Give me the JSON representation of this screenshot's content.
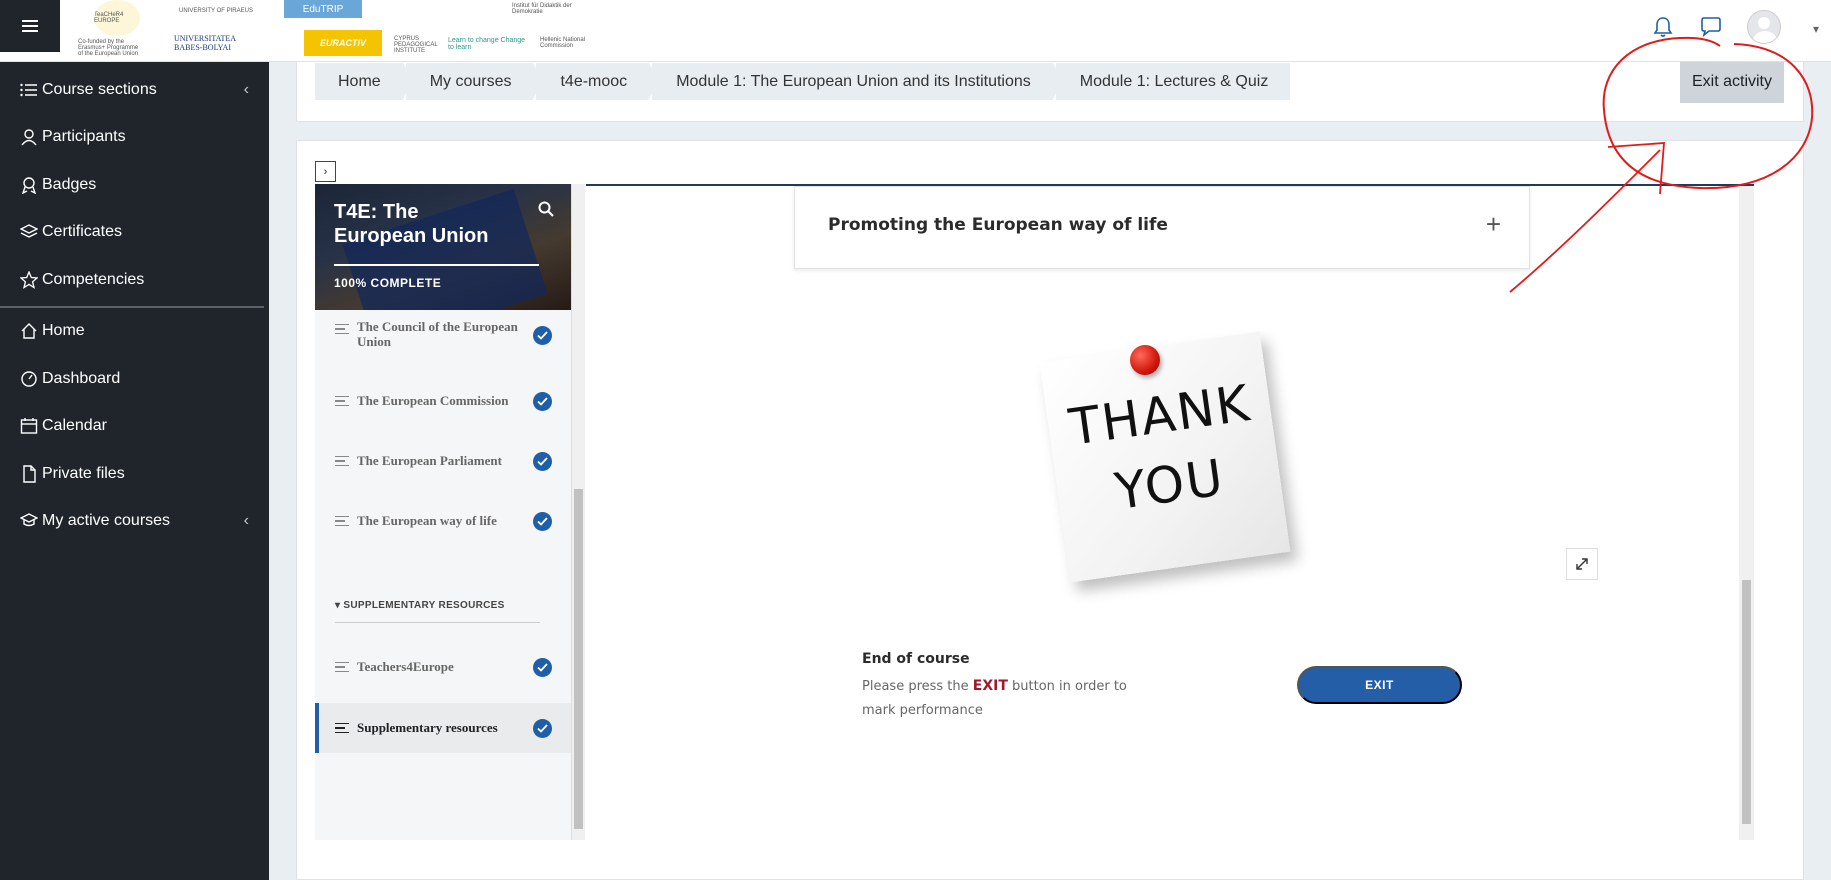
{
  "header": {
    "logos": [
      "TeaCHeR4 EUROPE",
      "UNIVERSITY OF PIRAEUS",
      "EduTRIP",
      "Co-funded by the Erasmus+ Programme of the European Union",
      "UNIVERSITATEA BABES-BOLYAI",
      "EURACTIV",
      "CYPRUS PEDAGOGICAL INSTITUTE",
      "Learn to change Change to learn",
      "Institut für Didaktik der Demokratie",
      "Hellenic National Commission"
    ]
  },
  "drawer": {
    "items": [
      {
        "label": "Course sections",
        "icon": "list-icon"
      },
      {
        "label": "Participants",
        "icon": "user-icon"
      },
      {
        "label": "Badges",
        "icon": "badge-icon"
      },
      {
        "label": "Certificates",
        "icon": "layers-icon"
      },
      {
        "label": "Competencies",
        "icon": "star-icon"
      },
      {
        "label": "Home",
        "icon": "home-icon"
      },
      {
        "label": "Dashboard",
        "icon": "gauge-icon"
      },
      {
        "label": "Calendar",
        "icon": "calendar-icon"
      },
      {
        "label": "Private files",
        "icon": "file-icon"
      },
      {
        "label": "My active courses",
        "icon": "graduation-cap-icon"
      }
    ]
  },
  "breadcrumb": [
    "Home",
    "My courses",
    "t4e-mooc",
    "Module 1: The European Union and its Institutions",
    "Module 1: Lectures & Quiz"
  ],
  "exit_activity_label": "Exit activity",
  "toc": {
    "title": "T4E: The European Union",
    "progress": "100% COMPLETE",
    "items": [
      "The Council of the European Union",
      "The European Commission",
      "The European Parliament",
      "The European way of life"
    ],
    "section_label": "SUPPLEMENTARY RESOURCES",
    "section_items": [
      "Teachers4Europe",
      "Supplementary resources"
    ]
  },
  "content": {
    "accordion_title": "Promoting the European way of life",
    "note_text_1": "THANK",
    "note_text_2": "YOU",
    "end_title": "End of course",
    "end_text_before": "Please press the ",
    "end_text_exit": "EXIT",
    "end_text_after": " button in order to mark performance",
    "exit_button": "EXIT"
  },
  "colors": {
    "drawer_bg": "#1f252b",
    "accent_blue": "#1f5fa8",
    "annotation_red": "#e01b1b"
  }
}
